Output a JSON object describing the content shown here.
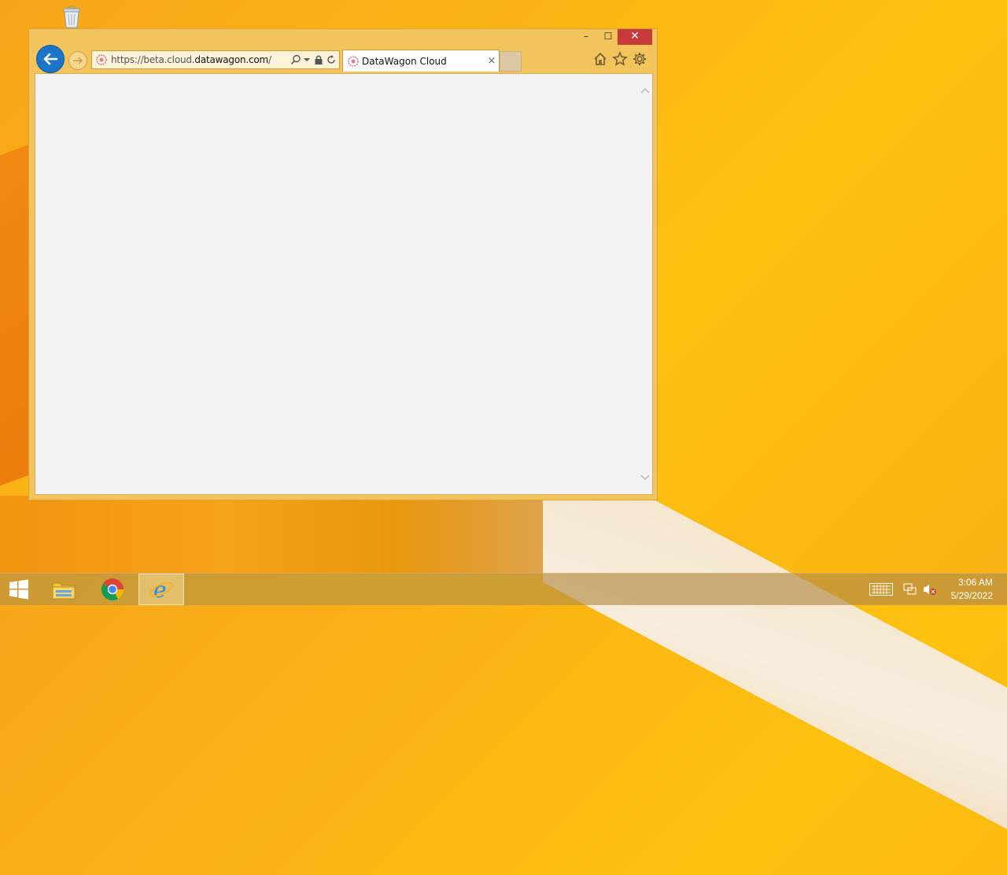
{
  "desktop": {
    "recycle_bin_icon": "recycle-bin-icon"
  },
  "browser": {
    "window_controls": {
      "minimize": "–",
      "maximize": "☐",
      "close": "✕"
    },
    "address_bar": {
      "url_prefix": "https://beta.cloud.",
      "url_domain": "datawagon.com",
      "url_suffix": "/"
    },
    "tab": {
      "title": "DataWagon Cloud",
      "close": "×"
    },
    "toolbar_icons": [
      "home-icon",
      "favorites-star-icon",
      "settings-gear-icon"
    ]
  },
  "taskbar": {
    "apps": [
      "start-button",
      "file-explorer-icon",
      "chrome-icon",
      "internet-explorer-icon"
    ],
    "active_app": "internet-explorer-icon",
    "clock": {
      "time": "3:06 AM",
      "date": "5/29/2022"
    },
    "tray": [
      "touch-keyboard-icon",
      "network-icon",
      "volume-muted-icon"
    ]
  },
  "colors": {
    "accent_blue": "#1c75c9",
    "close_red": "#c8393a",
    "window_frame": "#f3c45b"
  }
}
